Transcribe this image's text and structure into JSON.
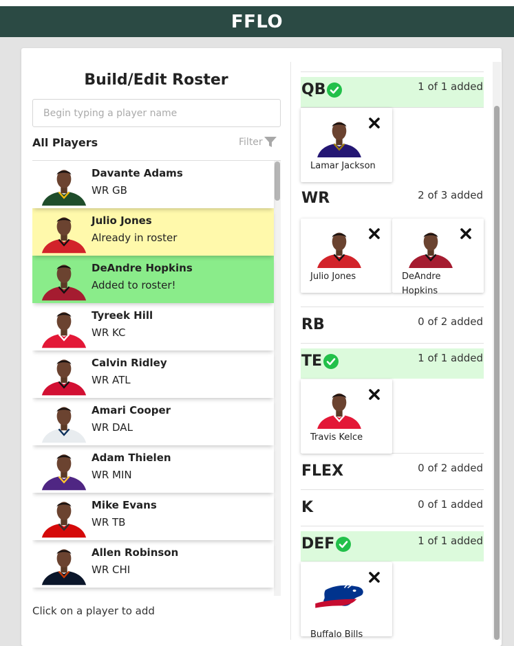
{
  "app": {
    "title": "FFLO"
  },
  "builder": {
    "title": "Build/Edit Roster",
    "search_placeholder": "Begin typing a player name",
    "list_heading": "All Players",
    "filter_label": "Filter",
    "hint": "Click on a player to add"
  },
  "players": [
    {
      "name": "Davante Adams",
      "detail": "WR GB",
      "state": "normal",
      "jersey": "#1f4d2b",
      "accent": "#f2b80c"
    },
    {
      "name": "Julio Jones",
      "detail": "Already in roster",
      "state": "in-roster",
      "jersey": "#d2232a",
      "accent": "#111111"
    },
    {
      "name": "DeAndre Hopkins",
      "detail": "Added to roster!",
      "state": "added",
      "jersey": "#a51c30",
      "accent": "#111111"
    },
    {
      "name": "Tyreek Hill",
      "detail": "WR KC",
      "state": "normal",
      "jersey": "#e31837",
      "accent": "#ffffff"
    },
    {
      "name": "Calvin Ridley",
      "detail": "WR ATL",
      "state": "normal",
      "jersey": "#d21033",
      "accent": "#111111"
    },
    {
      "name": "Amari Cooper",
      "detail": "WR DAL",
      "state": "normal",
      "jersey": "#e8ecef",
      "accent": "#0b2f5a"
    },
    {
      "name": "Adam Thielen",
      "detail": "WR MIN",
      "state": "normal",
      "jersey": "#4f2683",
      "accent": "#ffc62f"
    },
    {
      "name": "Mike Evans",
      "detail": "WR TB",
      "state": "normal",
      "jersey": "#d50a0a",
      "accent": "#34302b"
    },
    {
      "name": "Allen Robinson",
      "detail": "WR CHI",
      "state": "normal",
      "jersey": "#0b162a",
      "accent": "#c83803"
    }
  ],
  "row_colors": {
    "normal": "#ffffff",
    "in-roster": "#fff9ab",
    "added": "#8aec8a"
  },
  "positions": {
    "qb": {
      "label": "QB",
      "count": "1 of 1 added",
      "full": true
    },
    "wr": {
      "label": "WR",
      "count": "2 of 3 added",
      "full": false
    },
    "rb": {
      "label": "RB",
      "count": "0 of 2 added",
      "full": false
    },
    "te": {
      "label": "TE",
      "count": "1 of 1 added",
      "full": true
    },
    "flex": {
      "label": "FLEX",
      "count": "0 of 2 added",
      "full": false
    },
    "k": {
      "label": "K",
      "count": "0 of 1 added",
      "full": false
    },
    "def": {
      "label": "DEF",
      "count": "1 of 1 added",
      "full": true
    }
  },
  "roster": {
    "qb": [
      {
        "name": "Lamar Jackson",
        "jersey": "#241773",
        "accent": "#9e7c0c"
      }
    ],
    "wr": [
      {
        "name": "Julio Jones",
        "jersey": "#d2232a",
        "accent": "#111111"
      },
      {
        "name": "DeAndre Hopkins",
        "jersey": "#a51c30",
        "accent": "#111111"
      }
    ],
    "te": [
      {
        "name": "Travis Kelce",
        "jersey": "#e31837",
        "accent": "#ffffff"
      }
    ],
    "def": [
      {
        "name": "Buffalo Bills",
        "logo": "bills-logo"
      }
    ]
  },
  "colors": {
    "header": "#2b4a44",
    "full_position": "#dcfadc",
    "check": "#22c04a"
  }
}
